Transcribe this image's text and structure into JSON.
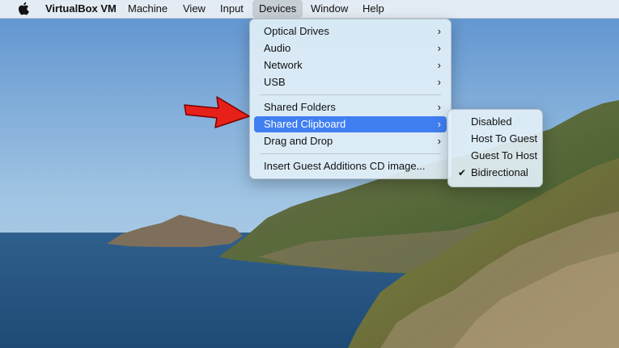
{
  "menubar": {
    "apple_icon": "apple-logo-icon",
    "items": [
      {
        "label": "VirtualBox VM"
      },
      {
        "label": "Machine"
      },
      {
        "label": "View"
      },
      {
        "label": "Input"
      },
      {
        "label": "Devices"
      },
      {
        "label": "Window"
      },
      {
        "label": "Help"
      }
    ]
  },
  "devices_menu": {
    "items": [
      {
        "label": "Optical Drives",
        "submenu_icon": "chevron-right-icon"
      },
      {
        "label": "Audio",
        "submenu_icon": "chevron-right-icon"
      },
      {
        "label": "Network",
        "submenu_icon": "chevron-right-icon"
      },
      {
        "label": "USB",
        "submenu_icon": "chevron-right-icon"
      },
      {
        "label": "Shared Folders",
        "submenu_icon": "chevron-right-icon"
      },
      {
        "label": "Shared Clipboard",
        "submenu_icon": "chevron-right-icon",
        "highlighted": true
      },
      {
        "label": "Drag and Drop",
        "submenu_icon": "chevron-right-icon"
      },
      {
        "label": "Insert Guest Additions CD image..."
      }
    ]
  },
  "clipboard_submenu": {
    "items": [
      {
        "label": "Disabled"
      },
      {
        "label": "Host To Guest"
      },
      {
        "label": "Guest To Host"
      },
      {
        "label": "Bidirectional",
        "checked": true
      }
    ]
  },
  "annotation": {
    "arrow_color": "#e8201a",
    "icon": "red-arrow-icon"
  },
  "colors": {
    "highlight": "#3f7ff2"
  }
}
